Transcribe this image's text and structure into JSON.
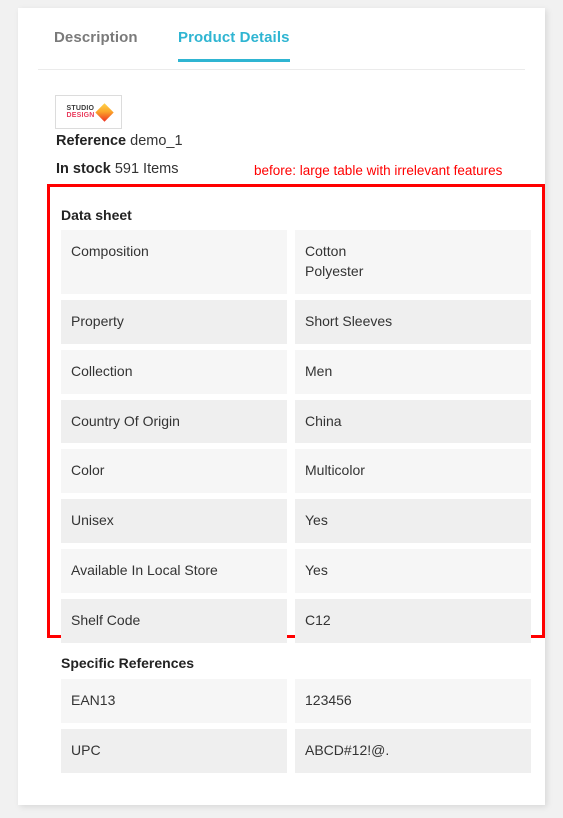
{
  "page": {
    "background_color": "#f1f1f1",
    "card_background": "#ffffff"
  },
  "tabs": [
    {
      "label": "Description",
      "active": false
    },
    {
      "label": "Product Details",
      "active": true
    }
  ],
  "brand": {
    "line1": "STUDIO",
    "line2": "DESIGN",
    "accent_color": "#ef3124"
  },
  "meta": {
    "reference_label": "Reference",
    "reference_value": "demo_1",
    "stock_label": "In stock",
    "stock_value": "591 Items"
  },
  "annotation": {
    "text": "before: large table with irrelevant features",
    "color": "#ff0000"
  },
  "data_sheet": {
    "title": "Data sheet",
    "rows": [
      {
        "key": "Composition",
        "value_lines": [
          "Cotton",
          "Polyester"
        ]
      },
      {
        "key": "Property",
        "value_lines": [
          "Short Sleeves"
        ]
      },
      {
        "key": "Collection",
        "value_lines": [
          "Men"
        ]
      },
      {
        "key": "Country Of Origin",
        "value_lines": [
          "China"
        ]
      },
      {
        "key": "Color",
        "value_lines": [
          "Multicolor"
        ]
      },
      {
        "key": "Unisex",
        "value_lines": [
          "Yes"
        ]
      },
      {
        "key": "Available In Local Store",
        "value_lines": [
          "Yes"
        ]
      },
      {
        "key": "Shelf Code",
        "value_lines": [
          "C12"
        ]
      }
    ]
  },
  "specific_references": {
    "title": "Specific References",
    "rows": [
      {
        "key": "EAN13",
        "value_lines": [
          "123456"
        ]
      },
      {
        "key": "UPC",
        "value_lines": [
          "ABCD#12!@."
        ]
      }
    ]
  }
}
